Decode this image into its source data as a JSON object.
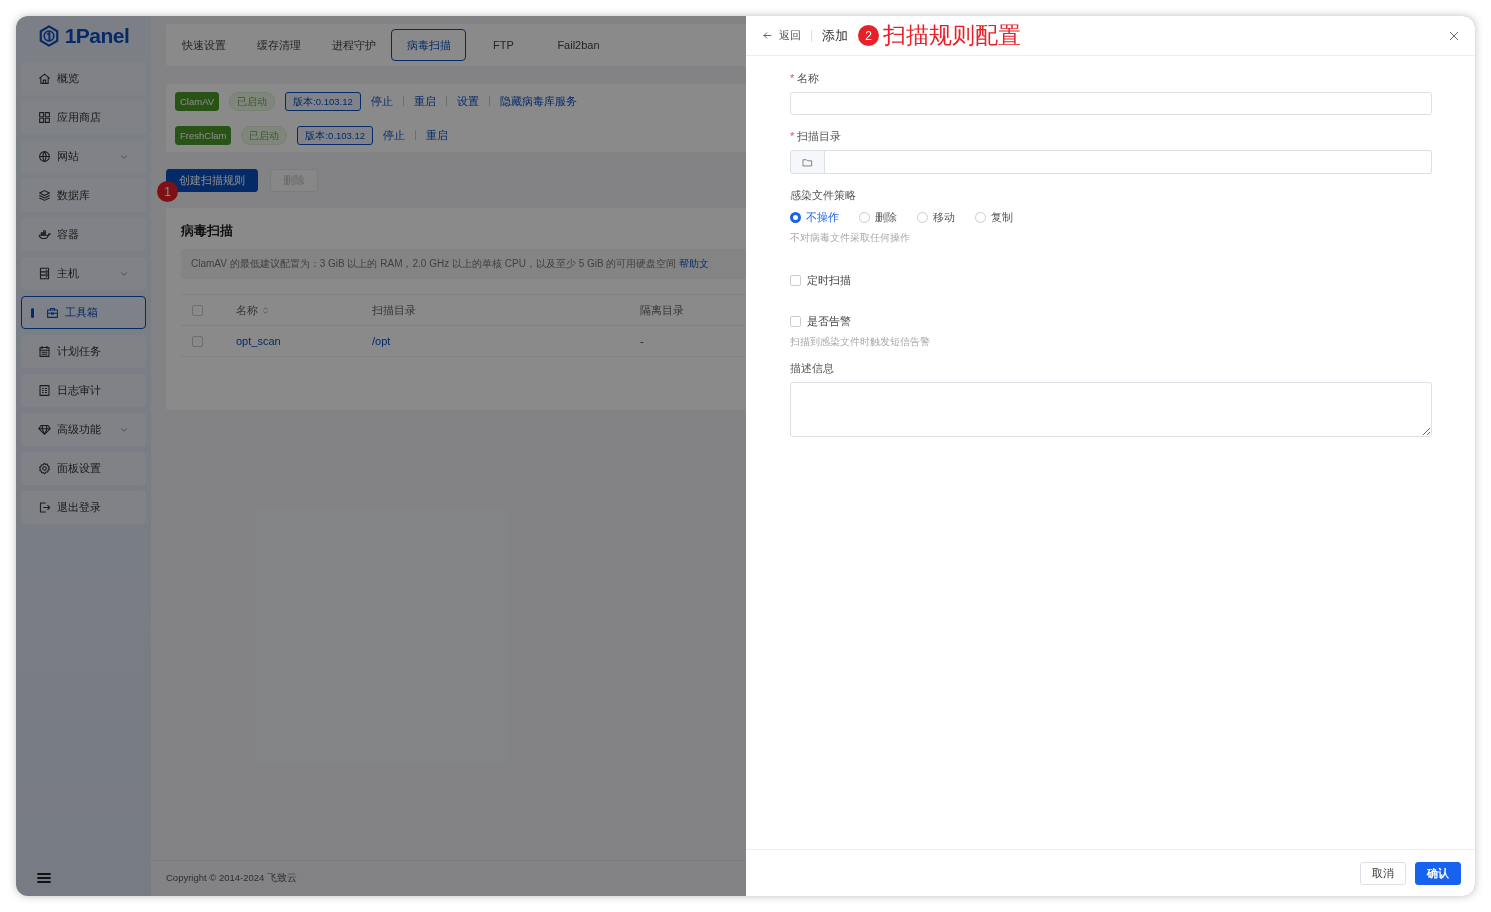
{
  "logo": {
    "text": "1Panel"
  },
  "sidebar": {
    "items": [
      {
        "label": "概览",
        "expandable": false,
        "selected": false
      },
      {
        "label": "应用商店",
        "expandable": false,
        "selected": false
      },
      {
        "label": "网站",
        "expandable": true,
        "selected": false
      },
      {
        "label": "数据库",
        "expandable": false,
        "selected": false
      },
      {
        "label": "容器",
        "expandable": false,
        "selected": false
      },
      {
        "label": "主机",
        "expandable": true,
        "selected": false
      },
      {
        "label": "工具箱",
        "expandable": false,
        "selected": true
      },
      {
        "label": "计划任务",
        "expandable": false,
        "selected": false
      },
      {
        "label": "日志审计",
        "expandable": false,
        "selected": false
      },
      {
        "label": "高级功能",
        "expandable": true,
        "selected": false
      },
      {
        "label": "面板设置",
        "expandable": false,
        "selected": false
      },
      {
        "label": "退出登录",
        "expandable": false,
        "selected": false
      }
    ]
  },
  "tabs": [
    {
      "label": "快速设置",
      "selected": false
    },
    {
      "label": "缓存清理",
      "selected": false
    },
    {
      "label": "进程守护",
      "selected": false
    },
    {
      "label": "病毒扫描",
      "selected": true
    },
    {
      "label": "FTP",
      "selected": false
    },
    {
      "label": "Fail2ban",
      "selected": false
    }
  ],
  "services": [
    {
      "name": "ClamAV",
      "status": "已启动",
      "version": "版本:0.103.12",
      "actions": [
        "停止",
        "重启",
        "设置",
        "隐藏病毒库服务"
      ]
    },
    {
      "name": "FreshClam",
      "status": "已启动",
      "version": "版本:0.103.12",
      "actions": [
        "停止",
        "重启"
      ]
    }
  ],
  "toolbar": {
    "buttons": [
      {
        "label": "创建扫描规则",
        "kind": "primary",
        "disabled": false,
        "marker": "1"
      },
      {
        "label": "删除",
        "kind": "plain",
        "disabled": true
      }
    ]
  },
  "panel": {
    "title": "病毒扫描",
    "notice": {
      "text": "ClamAV 的最低建议配置为：3 GiB 以上的 RAM，2.0 GHz 以上的单核 CPU，以及至少 5 GiB 的可用硬盘空间 ",
      "link": "帮助文"
    },
    "table": {
      "all_checked": false,
      "columns": [
        {
          "label": "名称",
          "sortable": true
        },
        {
          "label": "扫描目录",
          "sortable": false
        },
        {
          "label": "隔离目录",
          "sortable": false
        }
      ],
      "rows": [
        {
          "checked": false,
          "cells": [
            "opt_scan",
            "/opt",
            "-"
          ]
        }
      ]
    }
  },
  "footer": {
    "copyright": "Copyright © 2014-2024 飞致云"
  },
  "drawer": {
    "back": "返回",
    "title": "添加",
    "marker": "2",
    "heading": "扫描规则配置",
    "fields": [
      {
        "kind": "text",
        "label": "名称",
        "required_mark": "*"
      },
      {
        "kind": "directory",
        "label": "扫描目录",
        "required_mark": "*"
      },
      {
        "kind": "radio",
        "label": "感染文件策略",
        "options": [
          {
            "label": "不操作",
            "selected": true
          },
          {
            "label": "删除",
            "selected": false
          },
          {
            "label": "移动",
            "selected": false
          },
          {
            "label": "复制",
            "selected": false
          }
        ],
        "hint": "不对病毒文件采取任何操作"
      },
      {
        "kind": "checkbox",
        "label": "定时扫描",
        "checked": false
      },
      {
        "kind": "checkbox",
        "label": "是否告警",
        "checked": false,
        "hint": "扫描到感染文件时触发短信告警"
      },
      {
        "kind": "textarea",
        "label": "描述信息"
      }
    ],
    "buttons": [
      {
        "label": "取消",
        "kind": "plain"
      },
      {
        "label": "确认",
        "kind": "primary"
      }
    ]
  }
}
